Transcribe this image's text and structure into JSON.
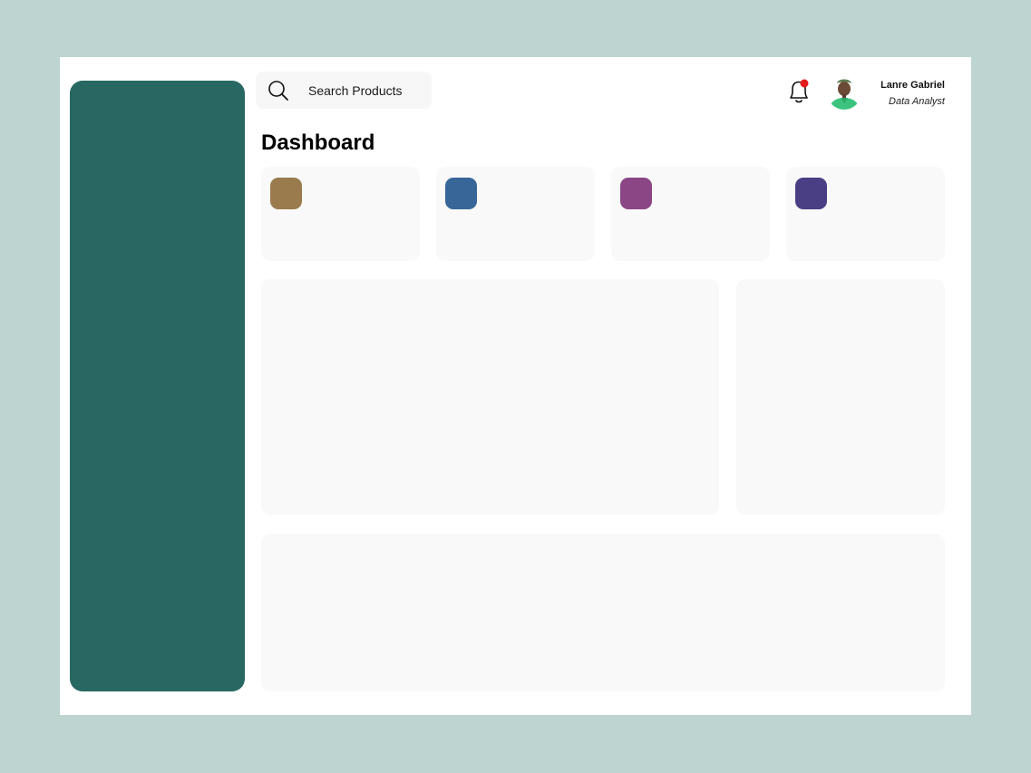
{
  "search": {
    "placeholder": "Search Products",
    "icon": "search-icon"
  },
  "header": {
    "notification_icon": "bell-icon",
    "notification_dot_color": "#e51b1b",
    "user": {
      "name": "Lanre Gabriel",
      "role": "Data Analyst"
    }
  },
  "page": {
    "title": "Dashboard"
  },
  "colors": {
    "background": "#bdd4d1",
    "sidebar": "#276862",
    "card": "#f9f9f9"
  },
  "stat_cards": [
    {
      "accent": "#9a7b4e"
    },
    {
      "accent": "#386698"
    },
    {
      "accent": "#8a4685"
    },
    {
      "accent": "#4a3e84"
    }
  ]
}
